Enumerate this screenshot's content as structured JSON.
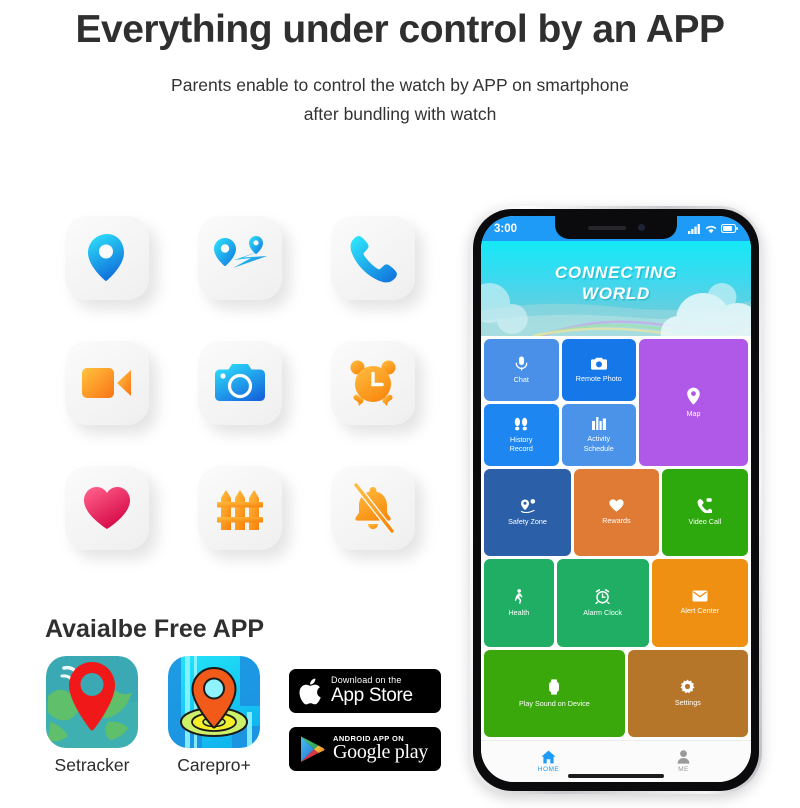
{
  "header": {
    "title": "Everything under control by an APP",
    "subtitle_line1": "Parents enable to control the watch by APP on smartphone",
    "subtitle_line2": "after bundling with watch"
  },
  "feature_icons": [
    {
      "name": "location-pin-icon",
      "label": "Location pin"
    },
    {
      "name": "route-map-icon",
      "label": "Route map"
    },
    {
      "name": "phone-call-icon",
      "label": "Phone call"
    },
    {
      "name": "video-camera-icon",
      "label": "Video camera"
    },
    {
      "name": "camera-icon",
      "label": "Camera"
    },
    {
      "name": "alarm-clock-icon",
      "label": "Alarm clock"
    },
    {
      "name": "heart-icon",
      "label": "Heart"
    },
    {
      "name": "fence-icon",
      "label": "Fence"
    },
    {
      "name": "bell-off-icon",
      "label": "Bell off"
    }
  ],
  "free_app": {
    "title": "Avaialbe Free APP",
    "apps": [
      {
        "name": "setracker",
        "caption": "Setracker"
      },
      {
        "name": "carepro",
        "caption": "Carepro+"
      }
    ],
    "badges": [
      {
        "name": "app-store-badge",
        "small": "Download on the",
        "big": "App Store"
      },
      {
        "name": "google-play-badge",
        "small": "ANDROID APP ON",
        "big": "Google play"
      }
    ]
  },
  "phone": {
    "status": {
      "time": "3:00",
      "signal": "signal-bars-icon",
      "wifi": "wifi-icon",
      "battery": "battery-icon"
    },
    "banner": {
      "line1": "CONNECTING",
      "line2": "WORLD"
    },
    "tiles": [
      {
        "label": "Chat",
        "icon": "microphone-icon",
        "color": "#4a90e8"
      },
      {
        "label": "Remote Photo",
        "icon": "camera-icon",
        "color": "#1678e8"
      },
      {
        "label": "Map",
        "icon": "map-pin-icon",
        "color": "#b058e8"
      },
      {
        "label": "History\nRecord",
        "icon": "footprints-icon",
        "color": "#1e86f0"
      },
      {
        "label": "Activity\nSchedule",
        "icon": "bar-chart-icon",
        "color": "#4b93e8"
      },
      {
        "label": "Safety Zone",
        "icon": "geofence-pin-icon",
        "color": "#2b5fa8"
      },
      {
        "label": "Rewards",
        "icon": "heart-icon",
        "color": "#e07b35"
      },
      {
        "label": "Video Call",
        "icon": "phone-video-icon",
        "color": "#2da80d"
      },
      {
        "label": "Health",
        "icon": "walking-icon",
        "color": "#1fae63"
      },
      {
        "label": "Alarm Clock",
        "icon": "alarm-clock-icon",
        "color": "#1fae63"
      },
      {
        "label": "Alert Center",
        "icon": "envelope-icon",
        "color": "#ef9012"
      },
      {
        "label": "Play Sound on Device",
        "icon": "watch-icon",
        "color": "#3aa80a"
      },
      {
        "label": "Settings",
        "icon": "gear-icon",
        "color": "#b5762a"
      }
    ],
    "navbar": [
      {
        "label": "HOME",
        "icon": "home-icon",
        "active": true
      },
      {
        "label": "ME",
        "icon": "person-icon",
        "active": false
      }
    ]
  },
  "colors": {
    "status_bar": "#1d9bf7",
    "banner_top": "#14e9f7",
    "accent_blue": "#1d9bf7",
    "heading": "#2f2f2f"
  }
}
